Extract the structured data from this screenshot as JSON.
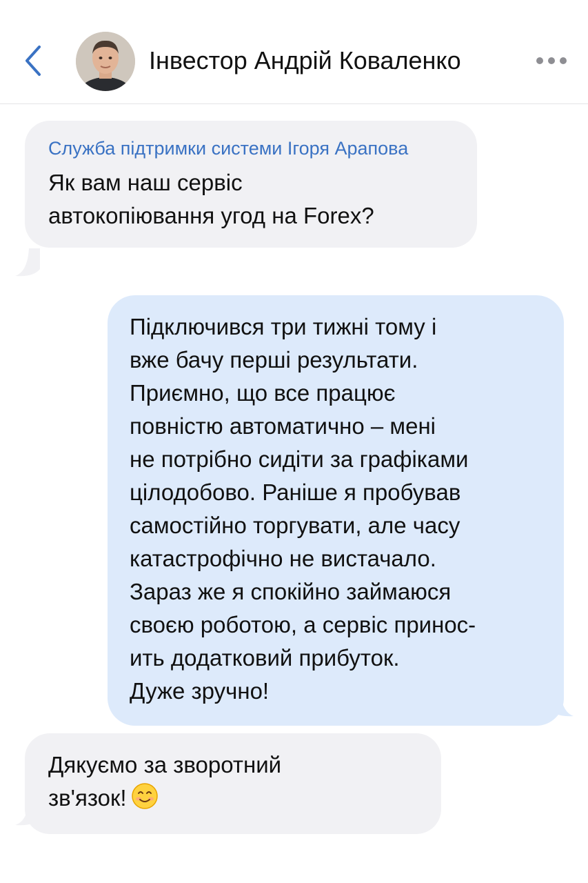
{
  "header": {
    "title": "Інвестор Андрій Коваленко",
    "back_icon": "chevron-left-icon",
    "more_icon": "more-horizontal-icon",
    "accent_color": "#3a72c3"
  },
  "messages": [
    {
      "direction": "incoming",
      "sender": "Служба підтримки системи Ігоря Арапова",
      "text": "Як вам наш сервіс\nавтокопіювання угод на Forex?"
    },
    {
      "direction": "outgoing",
      "text": "Підключився три тижні тому і\nвже бачу перші результати.\nПриємно, що все працює\nповністю автоматично – мені\nне потрібно сидіти за графіками\nцілодобово. Раніше я пробував\nсамостійно торгувати, але часу\nкатастрофічно не вистачало.\nЗараз же я спокійно займаюся\nсвоєю роботою, а сервіс принос-\nить додатковий прибуток.\nДуже зручно!"
    },
    {
      "direction": "incoming",
      "text": "Дякуємо за зворотний\nзв'язок!",
      "emoji": "smiling-face-emoji"
    }
  ],
  "colors": {
    "incoming_bubble": "#f1f1f4",
    "outgoing_bubble": "#ddeafb",
    "sender_name": "#3a72c3"
  }
}
